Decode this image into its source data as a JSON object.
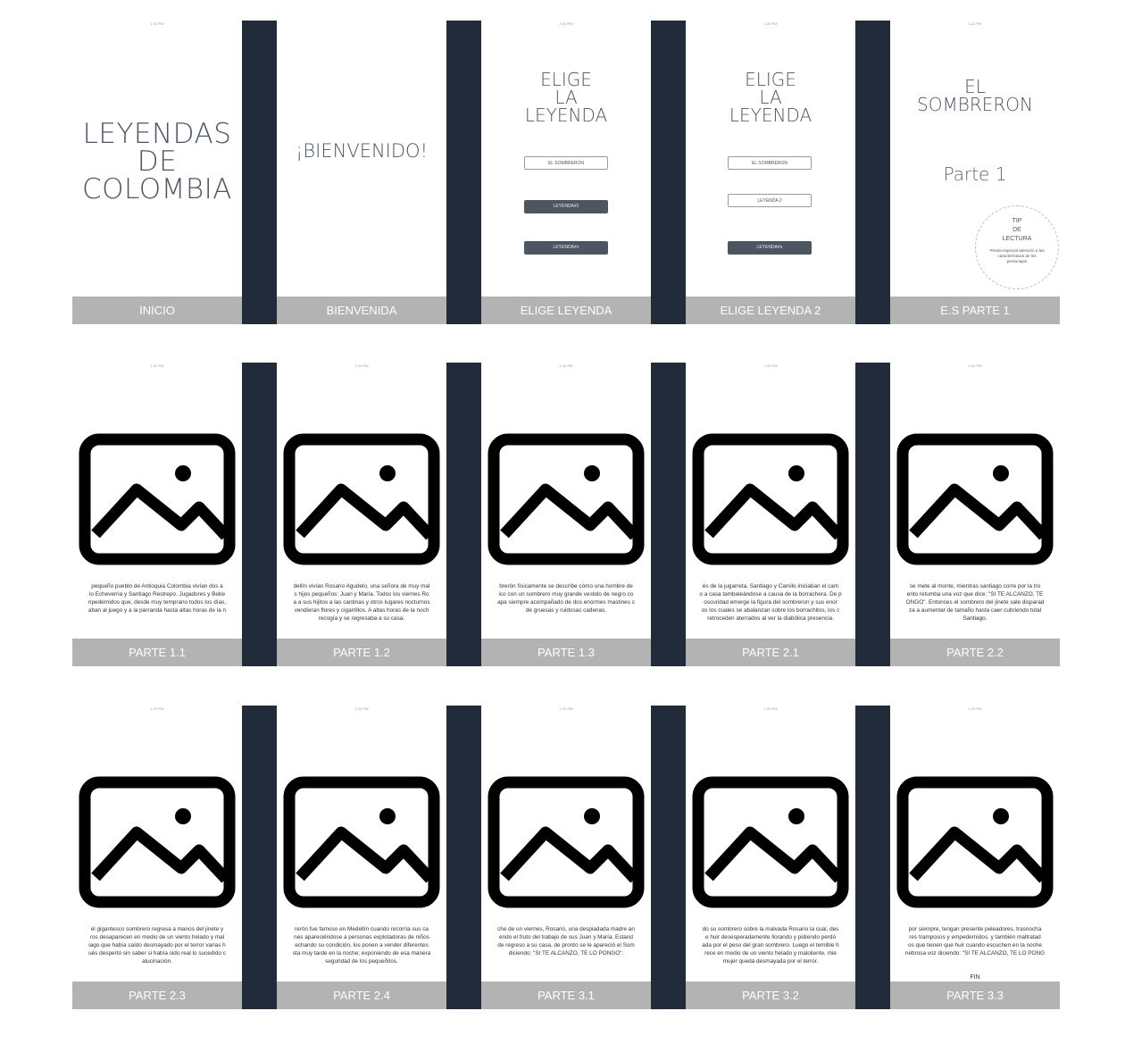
{
  "status_time": "1:20 PM",
  "screens_row1": {
    "inicio": {
      "title_lines": [
        "LEYENDAS",
        "DE",
        "COLOMBIA"
      ],
      "label": "INICIO"
    },
    "bienvenida": {
      "greeting": "¡BIENVENIDO!",
      "label": "BIENVENIDA"
    },
    "elige": {
      "title_lines": [
        "ELIGE",
        "LA",
        "LEYENDA"
      ],
      "buttons": [
        "EL SOMBRERON",
        "LEYENDA#2",
        "LEYENDA#n"
      ],
      "label": "ELIGE LEYENDA"
    },
    "elige2": {
      "title_lines": [
        "ELIGE",
        "LA",
        "LEYENDA"
      ],
      "buttons": [
        "EL SOMBRERON",
        "LEYENDA 2",
        "LEYENDA#n"
      ],
      "label": "ELIGE LEYENDA 2"
    },
    "es_parte1": {
      "title_lines": [
        "EL",
        "SOMBRERON"
      ],
      "subtitle": "Parte 1",
      "tip_title": [
        "TIP",
        "DE",
        "LECTURA"
      ],
      "tip_text": [
        "Presta especial atención a las",
        "características de los",
        "personajes"
      ],
      "label": "E.S PARTE 1"
    }
  },
  "screens_row2": [
    {
      "label": "PARTE 1.1",
      "text": [
        "pequeño pueblo de Antioquia Colombia vivían dos a",
        "lo Echeverria y Santiago Restrepo. Jugadores y Bebe",
        "npedernidos que, desde muy temprano todos los días,",
        "aban al juego y a la parranda hasta altas horas de la n"
      ]
    },
    {
      "label": "PARTE 1.2",
      "text": [
        "dellín vivían Rosario Agudelo, una señora de muy mal",
        "s hijos pequeños: Juan y María. Todos los viernes Ro",
        "a a sus hijitos a las cantinas y otros lugares nocturnos",
        "vendieran flores y cigarrillos. A altas horas de la noch",
        "recogía y se regresaba a su casa."
      ]
    },
    {
      "label": "PARTE 1.3",
      "text": [
        "brerón físicamente se describe cómo una hombre de",
        "ico con un sombrero muy grande vestido de negro co",
        "apa siempre acompañado de dos enormes mastines c",
        "de gruesas y ruidosas cadenas."
      ]
    },
    {
      "label": "PARTE 2.1",
      "text": [
        "és de la jugarreta, Santiago y Camilo iniciaban el cam",
        "o a casa tambaleándose a causa de la borrachera. De p",
        "oscuridad emerge la figura del sombreron y sus enor",
        "os los cuales se abalanzan sobre los borrachitos, los c",
        "retroceden aterrados al ver la diabólica presencia."
      ]
    },
    {
      "label": "PARTE 2.2",
      "text": [
        "se mete al monte, mientras santiago corre por la tro",
        "ento retumba una voz que dice: \"SI TE ALCANZO, TE",
        "ONGO\". Entonces el sombrero del jinete sale disparad",
        "za a aumentar de tamaño hasta caer cubriendo total",
        "Santiago."
      ]
    }
  ],
  "screens_row3": [
    {
      "label": "PARTE 2.3",
      "text": [
        "el gigantesco sombrero regresa a manos del jinete y",
        "ros desaparecen en medio de un viento helado y mal",
        "iago que había caído desmayado por el terror varias h",
        "ués despertó sin saber si había sido real lo sucedido c",
        "alucinación."
      ]
    },
    {
      "label": "PARTE 2.4",
      "text": [
        "rerón fue famoso en Medellín cuando recorría sus ca",
        "nes apareciéndose a personas explotadoras de niños",
        "echando su condición, los ponen a vender diferentes",
        "sta muy tarde en la noche; exponiendo de esa manera",
        "seguridad de los pequeñitos."
      ]
    },
    {
      "label": "PARTE 3.1",
      "text": [
        "che de un viernes, Rosario, una despiadada madre an",
        "endo el fruto del trabajo de sus Juan y María. Estand",
        "de regreso a su casa, de pronto se le apareció el Som",
        "diciendo: \"SI TE ALCANZO, TE LO PONGO\"."
      ]
    },
    {
      "label": "PARTE 3.2",
      "text": [
        "do su sombrero sobre la malvada Rosario la cual, des",
        "e huir desesperadamente llorando y pidiendo perdó",
        "ada por el peso del gran sombrero. Luego el temible h",
        "rece en medio de un viento helado y maloliente, mie",
        "mujer queda desmayada por el terror."
      ]
    },
    {
      "label": "PARTE 3.3",
      "text": [
        "por siempre, tengan presente peleadores, trasnocha",
        "res tramposos y empedernidos, y también maltratad",
        "os que tienen que huir cuando escuchen en la noche",
        "nebrosa voz diciendo: \"SI TE ALCANZO, TE LO PONG"
      ],
      "fin": "FIN"
    }
  ]
}
